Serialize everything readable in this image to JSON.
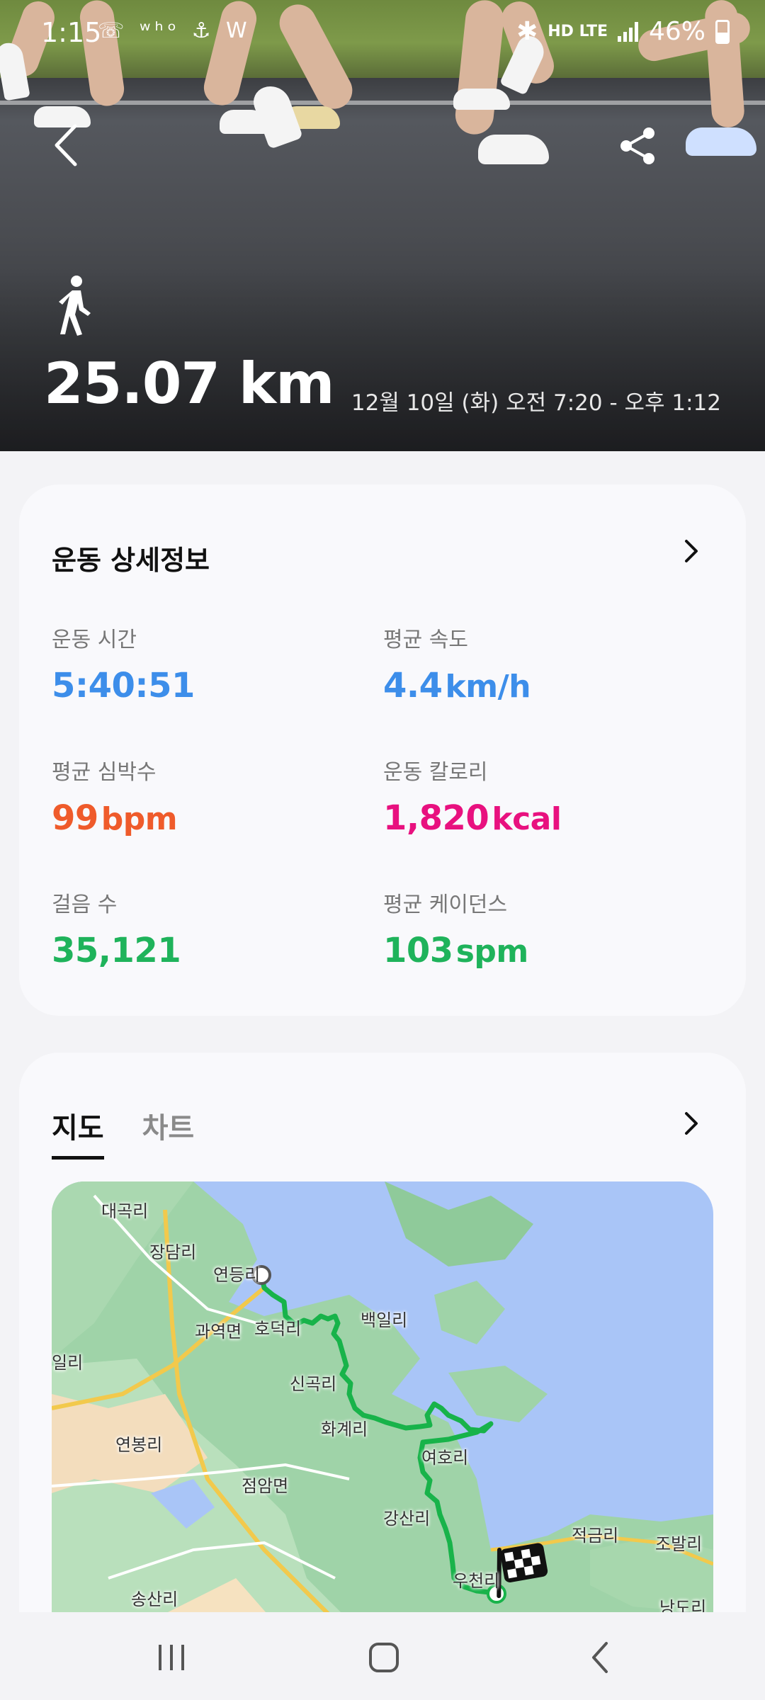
{
  "status_bar": {
    "time": "1:15",
    "notification_icons": "☏ ʷʰᵒ ⚓ W",
    "network": "HD LTE",
    "battery": "46%"
  },
  "hero": {
    "activity_icon": "walking-person-icon",
    "distance": "25.07 km",
    "datetime": "12월 10일 (화) 오전 7:20 - 오후 1:12"
  },
  "details": {
    "title": "운동 상세정보",
    "metrics": [
      {
        "label": "운동 시간",
        "value": "5:40:51",
        "unit": "",
        "color": "#3d8eea"
      },
      {
        "label": "평균 속도",
        "value": "4.4",
        "unit": "km/h",
        "color": "#3d8eea"
      },
      {
        "label": "평균 심박수",
        "value": "99",
        "unit": "bpm",
        "color": "#ef5b2b"
      },
      {
        "label": "운동 칼로리",
        "value": "1,820",
        "unit": "kcal",
        "color": "#e8117f"
      },
      {
        "label": "걸음 수",
        "value": "35,121",
        "unit": "",
        "color": "#1fb35b"
      },
      {
        "label": "평균 케이던스",
        "value": "103",
        "unit": "spm",
        "color": "#1fb35b"
      }
    ]
  },
  "map_card": {
    "tabs": [
      {
        "label": "지도",
        "active": true
      },
      {
        "label": "차트",
        "active": false
      }
    ],
    "route_color": "#18b34a",
    "places": [
      "대곡리",
      "장담리",
      "연등리",
      "과역면",
      "호덕리",
      "백일리",
      "일리",
      "신곡리",
      "화계리",
      "연봉리",
      "여호리",
      "점암면",
      "강산리",
      "적금리",
      "조발리",
      "우천리",
      "송산리",
      "낭도리"
    ]
  }
}
